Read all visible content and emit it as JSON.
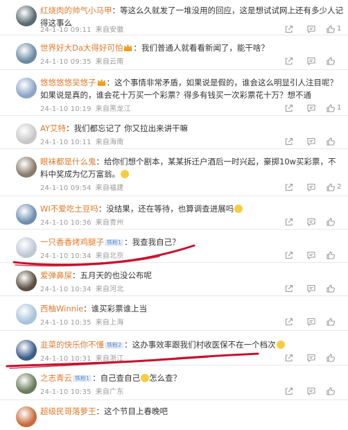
{
  "comments": [
    {
      "user": "红烧肉的帅气小马甲",
      "user_suffix": "",
      "badge": "",
      "text": "等这么久就发了一堆没用的回应，这是想试试网上还有多少人记得这事么",
      "emoji": false,
      "date": "24-1-10 09:11",
      "loc": "来自安徽",
      "likes": "1",
      "show_likes": true,
      "avatar_color": "#5a6b73"
    },
    {
      "user": "世界好大Da大得好可怕",
      "user_suffix": "",
      "badge": "",
      "text": "我们普通人就看看新闻了，能干啥？",
      "emoji": false,
      "date": "24-1-10 09:35",
      "loc": "来自云南",
      "likes": "",
      "show_likes": false,
      "avatar_color": "#6a8aa3"
    },
    {
      "user": "悠悠悠悠吴悠子",
      "user_suffix": "",
      "badge": "",
      "text": "这个事情非常矛盾，如果说是假的，谁会这么明显引人注目呢？如果说是真的，谁会花十万买一个彩票？得多有钱买一次彩票花十万？想不通",
      "emoji": false,
      "date": "24-1-10 10:19",
      "loc": "来自黑龙江",
      "likes": "1",
      "show_likes": true,
      "avatar_color": "#8da4c6"
    },
    {
      "user": "AY艾特",
      "user_suffix": "",
      "badge": "",
      "text": "我们都忘记了 你又拉出来讲干嘛",
      "emoji": false,
      "date": "24-1-10 10:11",
      "loc": "来自海南",
      "likes": "",
      "show_likes": false,
      "avatar_color": "#c8c8c8"
    },
    {
      "user": "眼袜都是什么鬼",
      "user_suffix": "",
      "badge": "",
      "text": "给你们想个剧本，某某拆迁户酒后一时兴起，豪掷10w买彩票，不料中奖成为亿万富翁。",
      "emoji": true,
      "date": "24-1-10 09:54",
      "loc": "来自福建",
      "likes": "2",
      "show_likes": true,
      "avatar_color": "#8a7a6a"
    },
    {
      "user": "WI不爱吃土豆吗",
      "user_suffix": "",
      "badge": "",
      "text": "没结果，还在等待，也算调查进展吗",
      "emoji": true,
      "date": "24-1-10 10:36",
      "loc": "来自贵州",
      "likes": "",
      "show_likes": false,
      "avatar_color": "#6f8fb0"
    },
    {
      "user": "一只香香烤鸡腿子",
      "user_suffix": "",
      "badge": "铁粉1",
      "text": "我查我自己？",
      "emoji": false,
      "date": "24-1-10 10:34",
      "loc": "来自北京",
      "likes": "",
      "show_likes": false,
      "avatar_color": "#c0c8d6"
    },
    {
      "user": "爱弹鼻屎",
      "user_suffix": "",
      "badge": "",
      "text": "五月天的也没公布呢",
      "emoji": false,
      "date": "24-1-10 10:34",
      "loc": "来自河北",
      "likes": "",
      "show_likes": false,
      "avatar_color": "#5c4e42"
    },
    {
      "user": "西柚Winnie",
      "user_suffix": "",
      "badge": "",
      "text": "谁买彩票谁上当",
      "emoji": false,
      "date": "24-1-10 10:35",
      "loc": "来自上海",
      "likes": "",
      "show_likes": false,
      "avatar_color": "#a9c3d9"
    },
    {
      "user": "韭菜的快乐你不懂",
      "user_suffix": "",
      "badge": "铁粉2",
      "text": "这办事效率跟我们村收医保不在一个档次",
      "emoji": true,
      "date": "24-1-10 10:31",
      "loc": "来自浙江",
      "likes": "",
      "show_likes": false,
      "avatar_color": "#3b5d8a"
    },
    {
      "user": "之志青云",
      "user_suffix": "",
      "badge": "铁粉1",
      "text": "自己查自己",
      "text2": "怎么查？",
      "emoji": true,
      "date": "24-1-10 10:35",
      "loc": "来自广东",
      "likes": "",
      "show_likes": false,
      "avatar_color": "#6a7c5a"
    },
    {
      "user": "超级民哥落萝王",
      "user_suffix": "",
      "badge": "",
      "text": "这个节目上春晚吧",
      "emoji": false,
      "date": "",
      "loc": "",
      "likes": "",
      "show_likes": false,
      "avatar_color": "#c96a3a"
    }
  ],
  "colors": {
    "username": "#e07a2c",
    "meta": "#9a9a9a",
    "scribble": "#c8102e",
    "badge_bg": "#e4ecf8"
  },
  "icons": {
    "share": "share-icon",
    "comment": "comment-icon",
    "like": "thumbs-up-icon",
    "crown": "crown-icon",
    "emoji": "emoji-icon"
  }
}
